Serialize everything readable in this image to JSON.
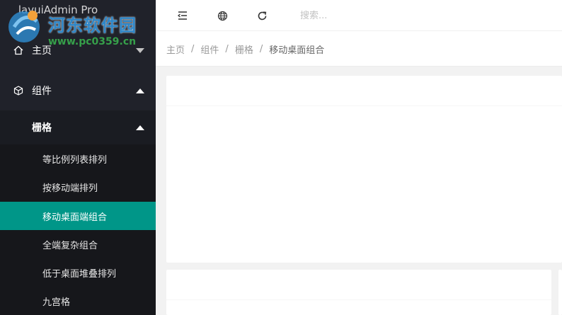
{
  "app": {
    "title": "layuiAdmin Pro"
  },
  "watermark": {
    "title": "河东软件园",
    "url": "www.pc0359.cn"
  },
  "sidebar": {
    "home": {
      "label": "主页",
      "icon": "home-icon"
    },
    "components": {
      "label": "组件",
      "icon": "cube-icon"
    },
    "grid": {
      "label": "栅格"
    },
    "sub_items": [
      {
        "label": "等比例列表排列"
      },
      {
        "label": "按移动端排列"
      },
      {
        "label": "移动桌面端组合"
      },
      {
        "label": "全端复杂组合"
      },
      {
        "label": "低于桌面堆叠排列"
      },
      {
        "label": "九宫格"
      }
    ],
    "active_index": 2
  },
  "header": {
    "icons": [
      "menu-collapse-icon",
      "globe-icon",
      "refresh-icon"
    ],
    "search_placeholder": "搜索..."
  },
  "breadcrumb": {
    "items": [
      "主页",
      "组件",
      "栅格",
      "移动桌面组合"
    ],
    "separator": "/"
  },
  "colors": {
    "sidebar_bg": "#20222a",
    "active": "#009688",
    "watermark_blue": "#2e87c9",
    "watermark_green": "#36a04a"
  }
}
